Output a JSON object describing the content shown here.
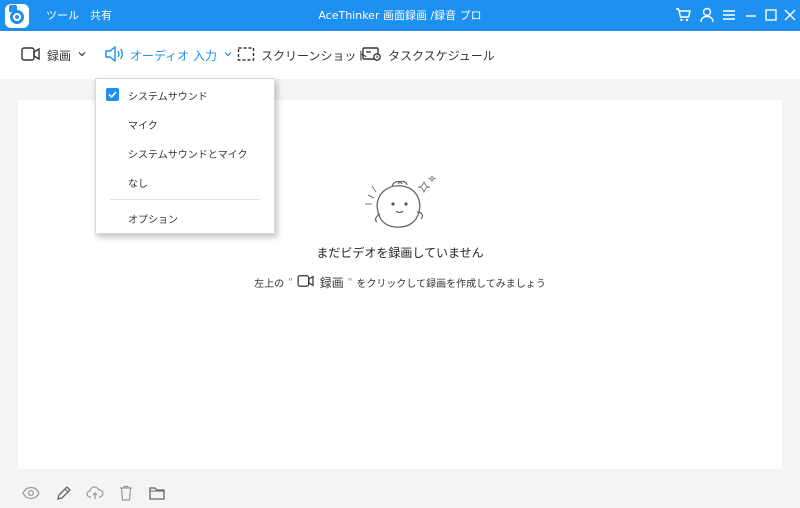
{
  "titlebar": {
    "menu": [
      "ツール",
      "共有"
    ],
    "title": "AceThinker 画面録画 /録音 プロ",
    "icons": [
      "cart-icon",
      "user-icon",
      "menu-icon",
      "minimize-icon",
      "maximize-icon",
      "close-icon"
    ]
  },
  "toolbar": {
    "record_label": "録画",
    "audio_label": "オーディオ 入力",
    "screenshot_label": "スクリーンショット",
    "schedule_label": "タスクスケジュール"
  },
  "audio_menu": {
    "items": [
      "システムサウンド",
      "マイク",
      "システムサウンドとマイク",
      "なし"
    ],
    "selected": "システムサウンド",
    "options_label": "オプション"
  },
  "empty_state": {
    "title": "まだビデオを録画していません",
    "hint_prefix": "左上の",
    "hint_quote": "\"",
    "hint_button": "録画",
    "hint_suffix": "をクリックして録画を作成してみましょう"
  },
  "bottombar": {
    "icons": [
      "preview-icon",
      "edit-icon",
      "upload-icon",
      "delete-icon",
      "folder-icon"
    ]
  },
  "colors": {
    "accent": "#1e90f0",
    "toolbar_bg": "#ffffff",
    "app_bg": "#f3f4f6"
  }
}
